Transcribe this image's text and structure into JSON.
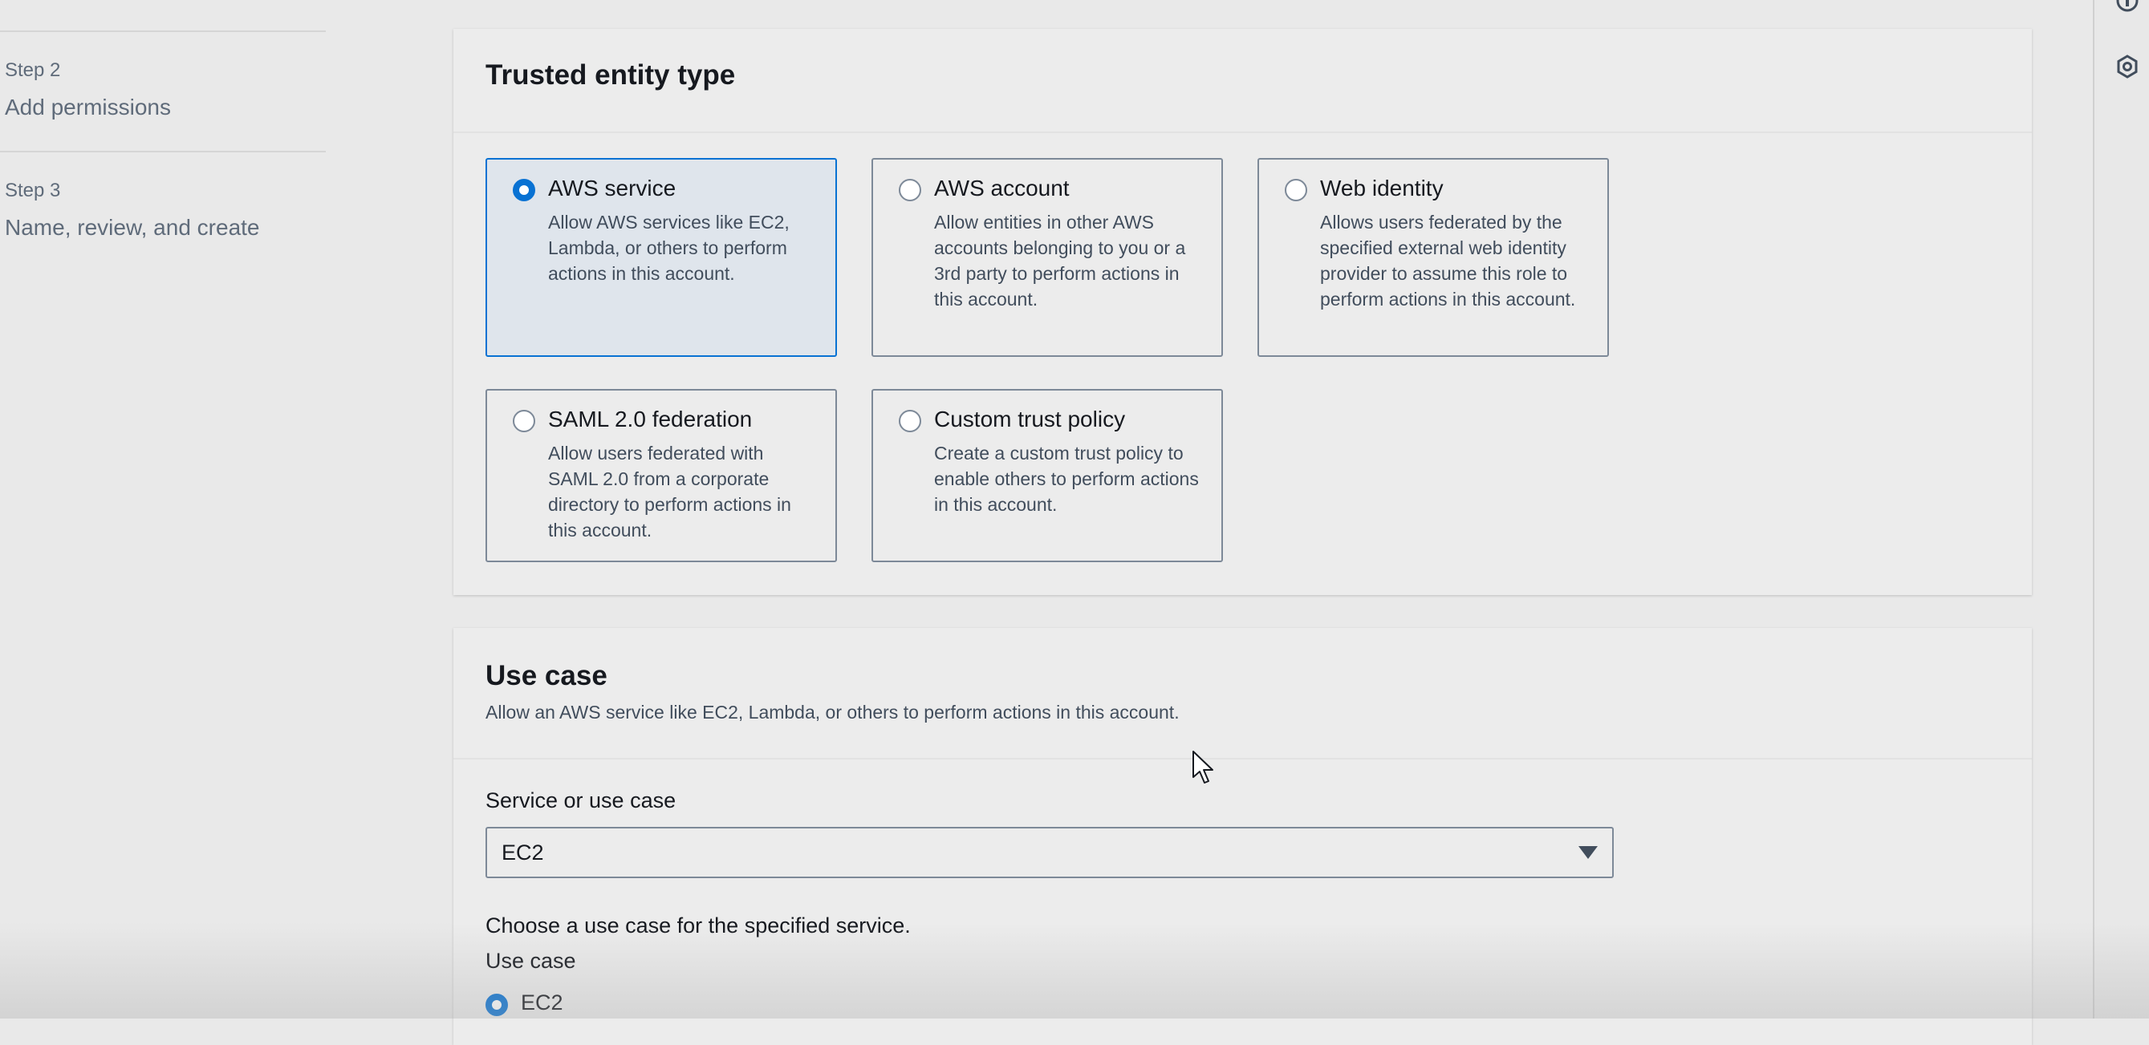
{
  "steps": [
    {
      "number": "Step 2",
      "title": "Add permissions"
    },
    {
      "number": "Step 3",
      "title": "Name, review, and create"
    }
  ],
  "trusted_entity": {
    "title": "Trusted entity type",
    "options": [
      {
        "label": "AWS service",
        "description": "Allow AWS services like EC2, Lambda, or others to perform actions in this account.",
        "selected": true
      },
      {
        "label": "AWS account",
        "description": "Allow entities in other AWS accounts belonging to you or a 3rd party to perform actions in this account.",
        "selected": false
      },
      {
        "label": "Web identity",
        "description": "Allows users federated by the specified external web identity provider to assume this role to perform actions in this account.",
        "selected": false
      },
      {
        "label": "SAML 2.0 federation",
        "description": "Allow users federated with SAML 2.0 from a corporate directory to perform actions in this account.",
        "selected": false
      },
      {
        "label": "Custom trust policy",
        "description": "Create a custom trust policy to enable others to perform actions in this account.",
        "selected": false
      }
    ]
  },
  "use_case": {
    "title": "Use case",
    "description": "Allow an AWS service like EC2, Lambda, or others to perform actions in this account.",
    "service_label": "Service or use case",
    "service_value": "EC2",
    "choose_text": "Choose a use case for the specified service.",
    "use_case_label": "Use case",
    "use_case_option": "EC2"
  },
  "colors": {
    "accent": "#0972d3",
    "selected_tile_bg": "#dfe5ec",
    "page_bg": "#e9e9e9"
  },
  "rail_icons": [
    "info-icon",
    "settings-hexagon-icon"
  ]
}
